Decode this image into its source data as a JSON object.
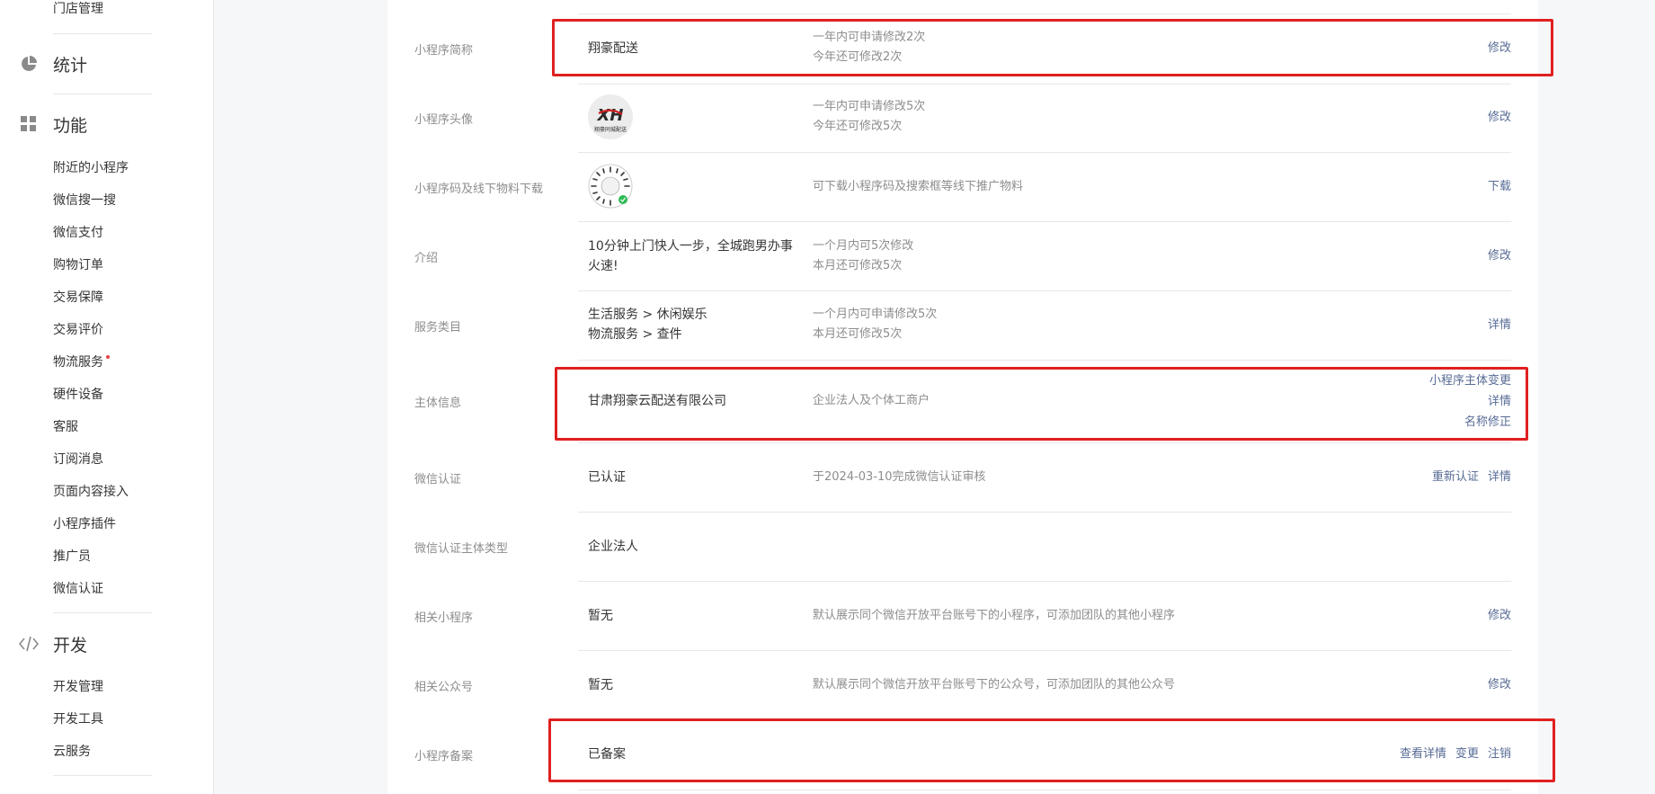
{
  "sidebar": {
    "top_item": "门店管理",
    "sections": [
      {
        "label": "统计",
        "icon": "pie-chart-icon"
      },
      {
        "label": "功能",
        "icon": "grid-icon"
      },
      {
        "label": "开发",
        "icon": "code-icon"
      }
    ],
    "function_items": [
      "附近的小程序",
      "微信搜一搜",
      "微信支付",
      "购物订单",
      "交易保障",
      "交易评价",
      "物流服务",
      "硬件设备",
      "客服",
      "订阅消息",
      "页面内容接入",
      "小程序插件",
      "推广员",
      "微信认证"
    ],
    "dev_items": [
      "开发管理",
      "开发工具",
      "云服务"
    ]
  },
  "rows": {
    "short_name": {
      "label": "小程序简称",
      "value": "翔豪配送",
      "desc1": "一年内可申请修改2次",
      "desc2": "今年还可修改2次",
      "action": "修改"
    },
    "avatar": {
      "label": "小程序头像",
      "logo_text": "XH",
      "logo_sub": "翔豪同城配送",
      "desc1": "一年内可申请修改5次",
      "desc2": "今年还可修改5次",
      "action": "修改"
    },
    "qrcode": {
      "label": "小程序码及线下物料下载",
      "desc": "可下载小程序码及搜索框等线下推广物料",
      "action": "下载"
    },
    "intro": {
      "label": "介绍",
      "value1": "10分钟上门快人一步，全城跑男办事",
      "value2": "火速!",
      "desc1": "一个月内可5次修改",
      "desc2": "本月还可修改5次",
      "action": "修改"
    },
    "category": {
      "label": "服务类目",
      "value1": "生活服务 > 休闲娱乐",
      "value2": "物流服务 > 查件",
      "desc1": "一个月内可申请修改5次",
      "desc2": "本月还可修改5次",
      "action": "详情"
    },
    "entity": {
      "label": "主体信息",
      "value": "甘肃翔豪云配送有限公司",
      "desc": "企业法人及个体工商户",
      "action1": "小程序主体变更",
      "action2": "详情",
      "action3": "名称修正"
    },
    "wx_verify": {
      "label": "微信认证",
      "value": "已认证",
      "desc": "于2024-03-10完成微信认证审核",
      "action1": "重新认证",
      "action2": "详情"
    },
    "verify_type": {
      "label": "微信认证主体类型",
      "value": "企业法人"
    },
    "related_mp": {
      "label": "相关小程序",
      "value": "暂无",
      "desc": "默认展示同个微信开放平台账号下的小程序，可添加团队的其他小程序",
      "action": "修改"
    },
    "related_oa": {
      "label": "相关公众号",
      "value": "暂无",
      "desc": "默认展示同个微信开放平台账号下的公众号，可添加团队的其他公众号",
      "action": "修改"
    },
    "filing": {
      "label": "小程序备案",
      "value": "已备案",
      "action1": "查看详情",
      "action2": "变更",
      "action3": "注销"
    }
  },
  "colors": {
    "link": "#576b95",
    "highlight": "#e02020",
    "muted": "#8d8d8d",
    "text": "#353535"
  }
}
